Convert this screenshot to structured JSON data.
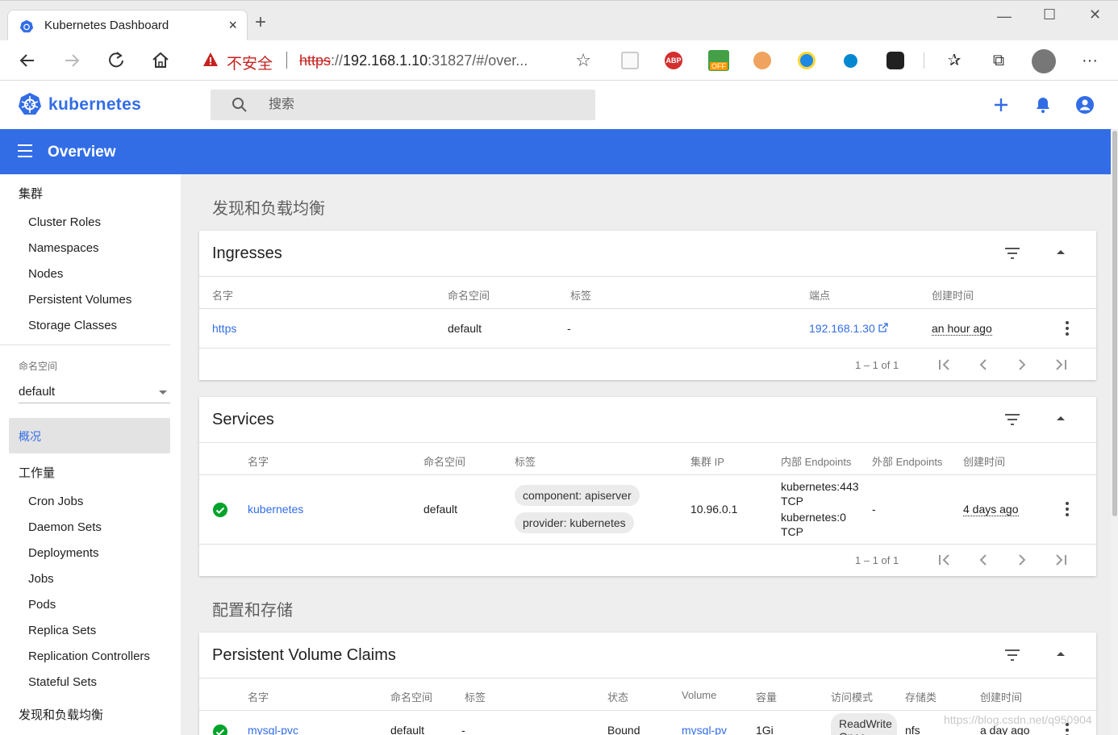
{
  "browser": {
    "tab_title": "Kubernetes Dashboard",
    "tab_close": "×",
    "new_tab": "+",
    "insecure_label": "不安全",
    "url_protocol": "https",
    "url_sep": "://",
    "url_host": "192.168.1.10",
    "url_rest": ":31827/#/over...",
    "ext_off_badge": "OFF",
    "ext_abp": "ABP"
  },
  "header": {
    "brand": "kubernetes",
    "search_placeholder": "搜索",
    "overview_title": "Overview"
  },
  "sidebar": {
    "cluster_heading": "集群",
    "cluster_items": [
      "Cluster Roles",
      "Namespaces",
      "Nodes",
      "Persistent Volumes",
      "Storage Classes"
    ],
    "namespace_label": "命名空间",
    "namespace_value": "default",
    "overview_item": "概况",
    "workloads_heading": "工作量",
    "workload_items": [
      "Cron Jobs",
      "Daemon Sets",
      "Deployments",
      "Jobs",
      "Pods",
      "Replica Sets",
      "Replication Controllers",
      "Stateful Sets"
    ],
    "discovery_heading": "发现和负载均衡"
  },
  "main": {
    "discovery_title": "发现和负载均衡",
    "config_title": "配置和存储",
    "ingresses": {
      "title": "Ingresses",
      "columns": [
        "名字",
        "命名空间",
        "标签",
        "端点",
        "创建时间"
      ],
      "row": {
        "name": "https",
        "namespace": "default",
        "labels": "-",
        "endpoint": "192.168.1.30",
        "created": "an hour ago"
      },
      "pager": "1 – 1 of 1"
    },
    "services": {
      "title": "Services",
      "columns": [
        "名字",
        "命名空间",
        "标签",
        "集群 IP",
        "内部 Endpoints",
        "外部 Endpoints",
        "创建时间"
      ],
      "row": {
        "name": "kubernetes",
        "namespace": "default",
        "labels": [
          "component: apiserver",
          "provider: kubernetes"
        ],
        "cluster_ip": "10.96.0.1",
        "internal_endpoints": [
          "kubernetes:443",
          "TCP",
          "kubernetes:0",
          "TCP"
        ],
        "external_endpoints": "-",
        "created": "4 days ago"
      },
      "pager": "1 – 1 of 1"
    },
    "pvc": {
      "title": "Persistent Volume Claims",
      "columns": [
        "名字",
        "命名空间",
        "标签",
        "状态",
        "Volume",
        "容量",
        "访问模式",
        "存储类",
        "创建时间"
      ],
      "row": {
        "name": "mysql-pvc",
        "namespace": "default",
        "labels": "-",
        "status": "Bound",
        "volume": "mysql-pv",
        "capacity": "1Gi",
        "access_mode": "ReadWrite Once",
        "storage_class": "nfs",
        "created": "a day ago"
      }
    }
  },
  "watermark": "https://blog.csdn.net/q950904",
  "colors": {
    "brand": "#326de6",
    "success": "#00a32a",
    "insecure": "#c5221f"
  }
}
